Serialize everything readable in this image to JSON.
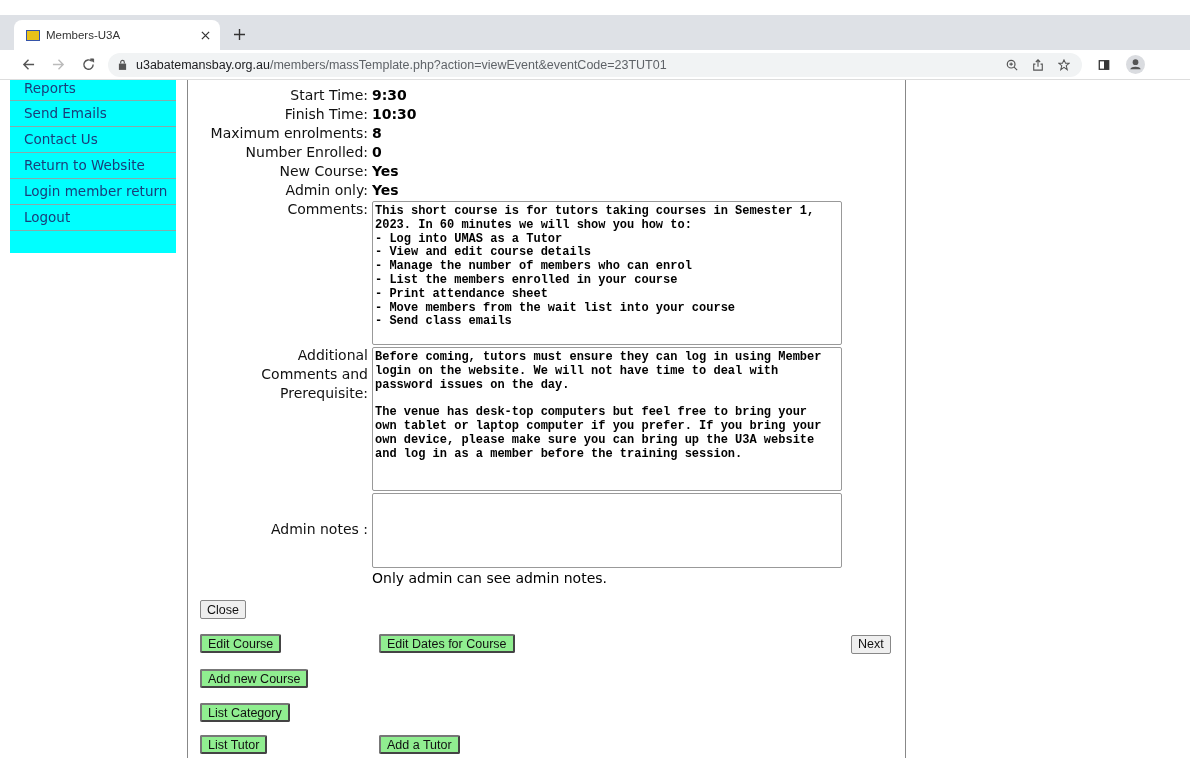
{
  "browser": {
    "tab_title": "Members-U3A",
    "url_domain": "u3abatemansbay.org.au",
    "url_path": "/members/massTemplate.php?action=viewEvent&eventCode=23TUT01"
  },
  "sidebar": {
    "items": [
      {
        "label": "Reports"
      },
      {
        "label": "Send Emails"
      },
      {
        "label": "Contact Us"
      },
      {
        "label": "Return to Website"
      },
      {
        "label": "Login member return"
      },
      {
        "label": "Logout"
      }
    ]
  },
  "details": [
    {
      "kind": "text",
      "label": "Start Time:",
      "value": "9:30"
    },
    {
      "kind": "text",
      "label": "Finish Time:",
      "value": "10:30"
    },
    {
      "kind": "text",
      "label": "Maximum enrolments:",
      "value": "8"
    },
    {
      "kind": "text",
      "label": "Number Enrolled:",
      "value": "0"
    },
    {
      "kind": "text",
      "label": "New Course:",
      "value": "Yes"
    },
    {
      "kind": "text",
      "label": "Admin only:",
      "value": "Yes"
    },
    {
      "kind": "textarea",
      "label": "Comments:",
      "value": "This short course is for tutors taking courses in Semester 1,\n2023. In 60 minutes we will show you how to:\n- Log into UMAS as a Tutor\n- View and edit course details\n- Manage the number of members who can enrol\n- List the members enrolled in your course\n- Print attendance sheet\n- Move members from the wait list into your course\n- Send class emails"
    },
    {
      "kind": "textarea",
      "label": "Additional Comments and Prerequisite:",
      "value": "Before coming, tutors must ensure they can log in using Member\nlogin on the website. We will not have time to deal with\npassword issues on the day.\n\nThe venue has desk-top computers but feel free to bring your\nown tablet or laptop computer if you prefer. If you bring your\nown device, please make sure you can bring up the U3A website\nand log in as a member before the training session."
    },
    {
      "kind": "notes",
      "label": "Admin notes :",
      "note": "Only admin can see admin notes."
    }
  ],
  "close_button": "Close",
  "button_rows": [
    {
      "left": "Edit Course",
      "middle": "Edit Dates for  Course",
      "right": "Next"
    },
    {
      "left": "Add new Course"
    },
    {
      "left": "List Category"
    },
    {
      "left": "List Tutor",
      "middle": "Add a Tutor"
    }
  ]
}
